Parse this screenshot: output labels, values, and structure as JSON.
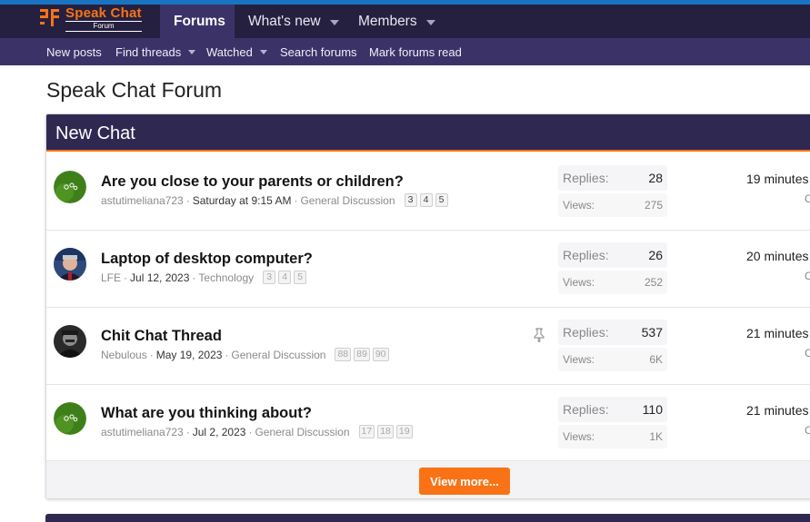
{
  "header": {
    "logo_title": "Speak Chat",
    "logo_sub": "Forum",
    "nav": [
      {
        "label": "Forums",
        "active": true
      },
      {
        "label": "What's new",
        "has_menu": true
      },
      {
        "label": "Members",
        "has_menu": true
      }
    ]
  },
  "subnav": [
    {
      "label": "New posts"
    },
    {
      "label": "Find threads",
      "has_menu": true
    },
    {
      "label": "Watched",
      "has_menu": true
    },
    {
      "label": "Search forums"
    },
    {
      "label": "Mark forums read"
    }
  ],
  "page_title": "Speak Chat Forum",
  "block": {
    "title": "New Chat",
    "threads": [
      {
        "title": "Are you close to your parents or children?",
        "author": "astutimeliana723",
        "date": "Saturday at 9:15 AM",
        "forum": "General Discussion",
        "pages": [
          "3",
          "4",
          "5"
        ],
        "replies_label": "Replies:",
        "replies": "28",
        "views_label": "Views:",
        "views": "275",
        "latest": "19 minutes",
        "latest_sub": "C",
        "avatar": "dandelion"
      },
      {
        "title": "Laptop of desktop computer?",
        "author": "LFE",
        "date": "Jul 12, 2023",
        "forum": "Technology",
        "pages": [
          "3",
          "4",
          "5"
        ],
        "replies_label": "Replies:",
        "replies": "26",
        "views_label": "Views:",
        "views": "252",
        "latest": "20 minutes",
        "latest_sub": "C",
        "avatar": "person"
      },
      {
        "title": "Chit Chat Thread",
        "author": "Nebulous",
        "date": "May 19, 2023",
        "forum": "General Discussion",
        "pages": [
          "88",
          "89",
          "90"
        ],
        "replies_label": "Replies:",
        "replies": "537",
        "views_label": "Views:",
        "views": "6K",
        "latest": "21 minutes",
        "latest_sub": "C",
        "avatar": "dark",
        "sticky": true
      },
      {
        "title": "What are you thinking about?",
        "author": "astutimeliana723",
        "date": "Jul 2, 2023",
        "forum": "General Discussion",
        "pages": [
          "17",
          "18",
          "19"
        ],
        "replies_label": "Replies:",
        "replies": "110",
        "views_label": "Views:",
        "views": "1K",
        "latest": "21 minutes",
        "latest_sub": "C",
        "avatar": "dandelion"
      }
    ],
    "view_more_label": "View more..."
  },
  "colors": {
    "accent": "#f97316",
    "topbar": "#25203f",
    "subbar": "#3b3368",
    "block_header": "#2f2952"
  }
}
